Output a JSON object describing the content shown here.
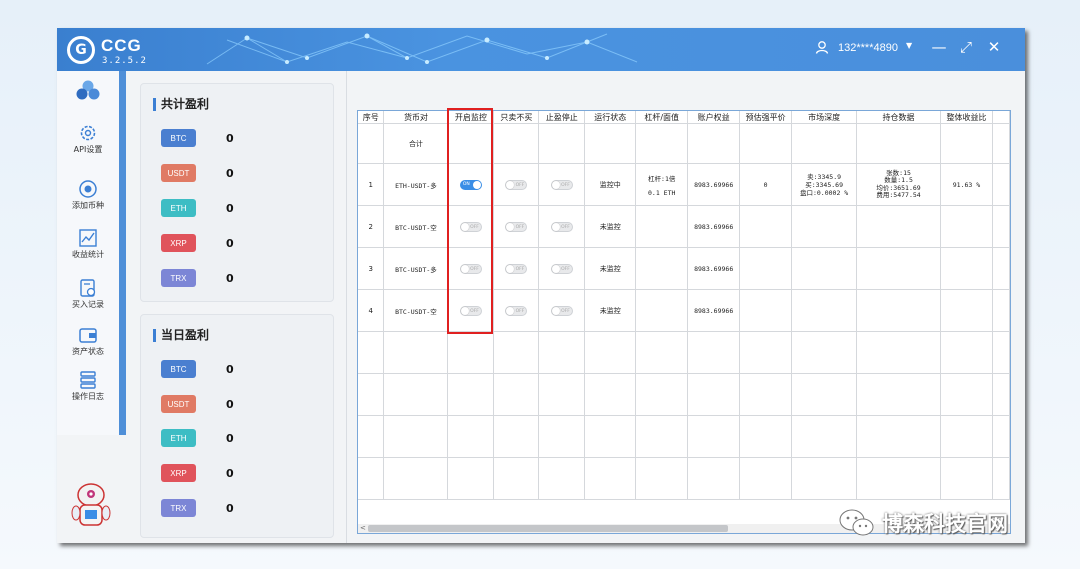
{
  "app": {
    "name": "CCG",
    "version": "3.2.5.2",
    "user": "132****4890"
  },
  "window": {
    "minimize": "—",
    "maximize": "⤢",
    "close": "✕"
  },
  "sidebar": {
    "items": [
      {
        "label": "",
        "icon": "logo-dots-icon"
      },
      {
        "label": "API设置",
        "icon": "gear-icon"
      },
      {
        "label": "添加币种",
        "icon": "add-coin-icon"
      },
      {
        "label": "收益统计",
        "icon": "chart-icon"
      },
      {
        "label": "买入记录",
        "icon": "record-icon"
      },
      {
        "label": "资产状态",
        "icon": "wallet-icon"
      },
      {
        "label": "操作日志",
        "icon": "log-icon"
      }
    ]
  },
  "total_profit": {
    "title": "共计盈利",
    "coins": [
      {
        "name": "BTC",
        "value": "0",
        "color": "#4a7fd0"
      },
      {
        "name": "USDT",
        "value": "0",
        "color": "#e07a64"
      },
      {
        "name": "ETH",
        "value": "0",
        "color": "#3dbdc4"
      },
      {
        "name": "XRP",
        "value": "0",
        "color": "#e0535b"
      },
      {
        "name": "TRX",
        "value": "0",
        "color": "#7c86d6"
      }
    ]
  },
  "daily_profit": {
    "title": "当日盈利",
    "coins": [
      {
        "name": "BTC",
        "value": "0",
        "color": "#4a7fd0"
      },
      {
        "name": "USDT",
        "value": "0",
        "color": "#e07a64"
      },
      {
        "name": "ETH",
        "value": "0",
        "color": "#3dbdc4"
      },
      {
        "name": "XRP",
        "value": "0",
        "color": "#e0535b"
      },
      {
        "name": "TRX",
        "value": "0",
        "color": "#7c86d6"
      }
    ]
  },
  "table": {
    "headers": [
      "序号",
      "货币对",
      "开启监控",
      "只卖不买",
      "止盈停止",
      "运行状态",
      "杠杆/面值",
      "账户权益",
      "预估强平价",
      "市场深度",
      "持仓数据",
      "整体收益比"
    ],
    "total_label": "合计",
    "rows": [
      {
        "idx": "1",
        "pair": "ETH-USDT-多",
        "monitor": "ON",
        "sell_only": "OFF",
        "tp_stop": "OFF",
        "status": "监控中",
        "leverage": [
          "杠杆:1倍",
          "0.1 ETH"
        ],
        "equity": "8983.69966",
        "liq_price": "0",
        "depth": [
          "卖:3345.9",
          "买:3345.69",
          "盘口:0.0002 %"
        ],
        "position": [
          "张数:15",
          "数量:1.5",
          "均价:3651.69",
          "费用:5477.54"
        ],
        "pnl_ratio": "91.63 %"
      },
      {
        "idx": "2",
        "pair": "BTC-USDT-空",
        "monitor": "OFF",
        "sell_only": "OFF",
        "tp_stop": "OFF",
        "status": "未监控",
        "leverage": [],
        "equity": "8983.69966",
        "liq_price": "",
        "depth": [],
        "position": [],
        "pnl_ratio": ""
      },
      {
        "idx": "3",
        "pair": "BTC-USDT-多",
        "monitor": "OFF",
        "sell_only": "OFF",
        "tp_stop": "OFF",
        "status": "未监控",
        "leverage": [],
        "equity": "8983.69966",
        "liq_price": "",
        "depth": [],
        "position": [],
        "pnl_ratio": ""
      },
      {
        "idx": "4",
        "pair": "BTC-USDT-空",
        "monitor": "OFF",
        "sell_only": "OFF",
        "tp_stop": "OFF",
        "status": "未监控",
        "leverage": [],
        "equity": "8983.69966",
        "liq_price": "",
        "depth": [],
        "position": [],
        "pnl_ratio": ""
      }
    ],
    "empty_rows": 4
  },
  "scroll": {
    "left_arrow": "<"
  },
  "watermark": "博森科技官网"
}
